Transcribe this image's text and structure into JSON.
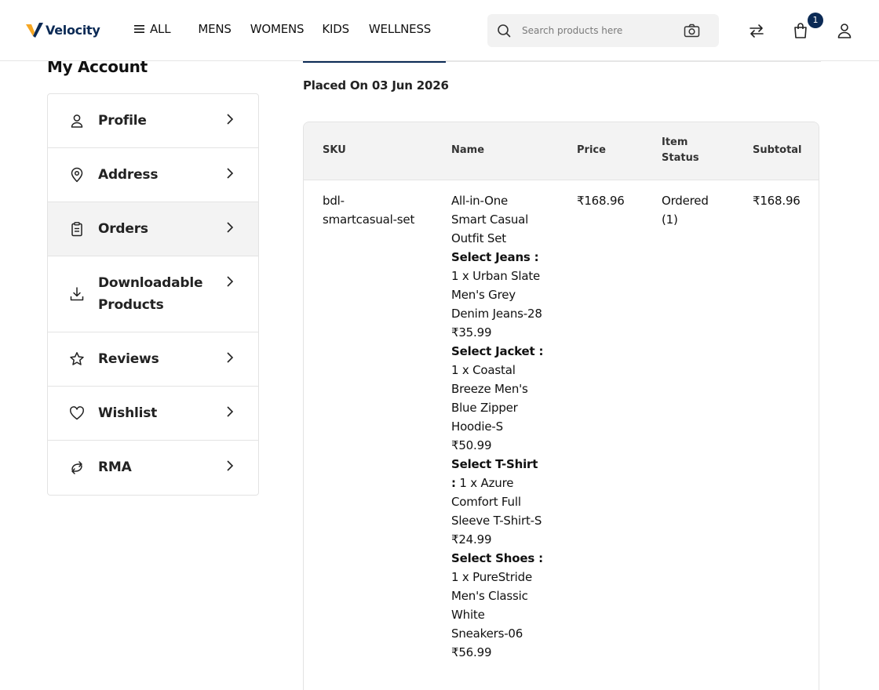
{
  "header": {
    "logo_text": "Velocity",
    "nav": {
      "all": "ALL",
      "mens": "MENS",
      "womens": "WOMENS",
      "kids": "KIDS",
      "wellness": "WELLNESS"
    },
    "search_placeholder": "Search products here",
    "cart_count": "1"
  },
  "sidebar": {
    "title": "My Account",
    "items": [
      {
        "label": "Profile",
        "icon": "user-icon"
      },
      {
        "label": "Address",
        "icon": "map-pin-icon"
      },
      {
        "label": "Orders",
        "icon": "clipboard-icon",
        "active": true
      },
      {
        "label": "Downloadable Products",
        "icon": "download-icon"
      },
      {
        "label": "Reviews",
        "icon": "star-icon"
      },
      {
        "label": "Wishlist",
        "icon": "heart-icon"
      },
      {
        "label": "RMA",
        "icon": "return-icon"
      }
    ]
  },
  "order": {
    "placed_on": "Placed On 03 Jun 2026",
    "columns": {
      "sku": "SKU",
      "name": "Name",
      "price": "Price",
      "item_status": "Item Status",
      "subtotal": "Subtotal"
    },
    "row": {
      "sku": "bdl-smartcasual-set",
      "name": "All-in-One Smart Casual Outfit Set",
      "options": [
        {
          "label": "Select Jeans :",
          "value": "1 x Urban Slate Men's Grey Denim Jeans-28",
          "price": "₹35.99"
        },
        {
          "label": "Select Jacket :",
          "value": "1 x Coastal Breeze Men's Blue Zipper Hoodie-S",
          "price": "₹50.99"
        },
        {
          "label": "Select T-Shirt :",
          "value": "1 x Azure Comfort Full Sleeve T-Shirt-S",
          "price": "₹24.99"
        },
        {
          "label": "Select Shoes :",
          "value": "1 x PureStride Men's Classic White Sneakers-06",
          "price": "₹56.99"
        }
      ],
      "price": "₹168.96",
      "status": "Ordered (1)",
      "subtotal": "₹168.96"
    }
  },
  "colors": {
    "brand_navy": "#0b2a55",
    "logo_orange": "#f5a623",
    "active_bg": "#f3f3f3"
  }
}
